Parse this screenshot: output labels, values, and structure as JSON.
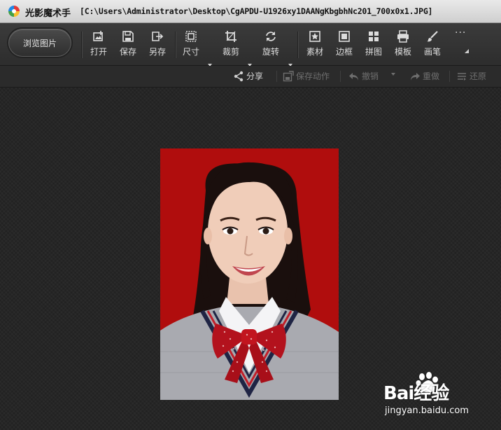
{
  "window": {
    "app_name": "光影魔术手",
    "file_path": "[C:\\Users\\Administrator\\Desktop\\CgAPDU-U1926xy1DAANgKbgbhNc201_700x0x1.JPG]"
  },
  "toolbar": {
    "browse_label": "浏览图片",
    "tools": [
      {
        "label": "打开",
        "icon": "open-image-icon"
      },
      {
        "label": "保存",
        "icon": "save-icon"
      },
      {
        "label": "另存",
        "icon": "save-as-icon"
      },
      {
        "label": "尺寸",
        "icon": "resize-icon",
        "dropdown": true
      },
      {
        "label": "裁剪",
        "icon": "crop-icon",
        "dropdown": true
      },
      {
        "label": "旋转",
        "icon": "rotate-icon",
        "dropdown": true
      },
      {
        "label": "素材",
        "icon": "material-icon"
      },
      {
        "label": "边框",
        "icon": "border-icon"
      },
      {
        "label": "拼图",
        "icon": "collage-icon"
      },
      {
        "label": "模板",
        "icon": "template-icon"
      },
      {
        "label": "画笔",
        "icon": "brush-icon"
      }
    ],
    "more_label": "···"
  },
  "actions": {
    "share": "分享",
    "save_action": "保存动作",
    "undo": "撤销",
    "redo": "重做",
    "restore": "还原"
  },
  "colors": {
    "photo_background": "#b00d0d",
    "active_text": "#d9d9d9",
    "disabled_text": "#6e6e6e"
  },
  "watermark": {
    "brand": "Bai经验",
    "url": "jingyan.baidu.com"
  }
}
